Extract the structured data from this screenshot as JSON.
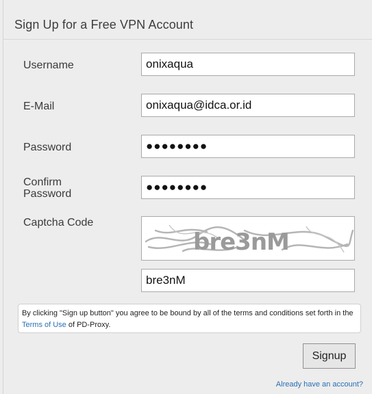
{
  "form": {
    "title": "Sign Up for a Free VPN Account",
    "username": {
      "label": "Username",
      "value": "onixaqua"
    },
    "email": {
      "label": "E-Mail",
      "value": "onixaqua@idca.or.id"
    },
    "password": {
      "label": "Password",
      "value": "●●●●●●●●"
    },
    "confirm_password": {
      "label_line1": "Confirm",
      "label_line2": "Password",
      "value": "●●●●●●●●"
    },
    "captcha": {
      "label": "Captcha Code",
      "image_text": "bre3nM",
      "value": "bre3nM"
    },
    "notice": {
      "text_before": "By clicking \"Sign up button\" you agree to be bound by all of the terms and conditions set forth in the",
      "link": "Terms of Use",
      "text_after": " of PD-Proxy."
    },
    "submit_label": "Signup",
    "signin_link": "Already have an account?"
  },
  "colors": {
    "background": "#ededed",
    "link": "#2a6fb4"
  }
}
